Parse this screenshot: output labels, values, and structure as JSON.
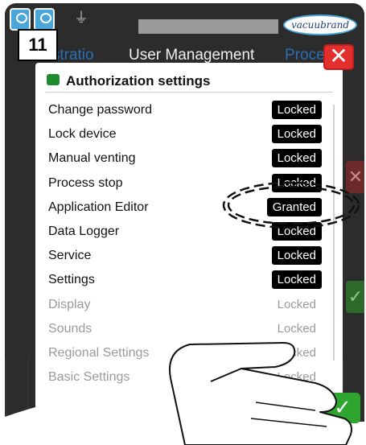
{
  "step_number": "11",
  "brand": "vacuubrand",
  "tabs": {
    "administration": "nistratio",
    "user_management": "User Management",
    "process": "Proce"
  },
  "dialog": {
    "title": "Authorization settings",
    "rows": [
      {
        "label": "Change password",
        "status": "Locked",
        "state": "active"
      },
      {
        "label": "Lock device",
        "status": "Locked",
        "state": "active"
      },
      {
        "label": "Manual venting",
        "status": "Locked",
        "state": "active"
      },
      {
        "label": "Process stop",
        "status": "Locked",
        "state": "active"
      },
      {
        "label": "Application Editor",
        "status": "Granted",
        "state": "active"
      },
      {
        "label": "Data Logger",
        "status": "Locked",
        "state": "active"
      },
      {
        "label": "Service",
        "status": "Locked",
        "state": "active"
      },
      {
        "label": "Settings",
        "status": "Locked",
        "state": "active"
      },
      {
        "label": "Display",
        "status": "Locked",
        "state": "disabled"
      },
      {
        "label": "Sounds",
        "status": "Locked",
        "state": "disabled"
      },
      {
        "label": "Regional Settings",
        "status": "Locked",
        "state": "disabled"
      },
      {
        "label": "Basic Settings",
        "status": "Locked",
        "state": "disabled"
      }
    ]
  },
  "icons": {
    "close": "close-icon",
    "confirm": "checkmark-icon",
    "connection": "plug-icon",
    "home": "home-icon"
  },
  "colors": {
    "close_button": "#e3302f",
    "confirm_button": "#2ea52e",
    "status_badge": "#000000",
    "accent_blue": "#4aa6d8"
  }
}
